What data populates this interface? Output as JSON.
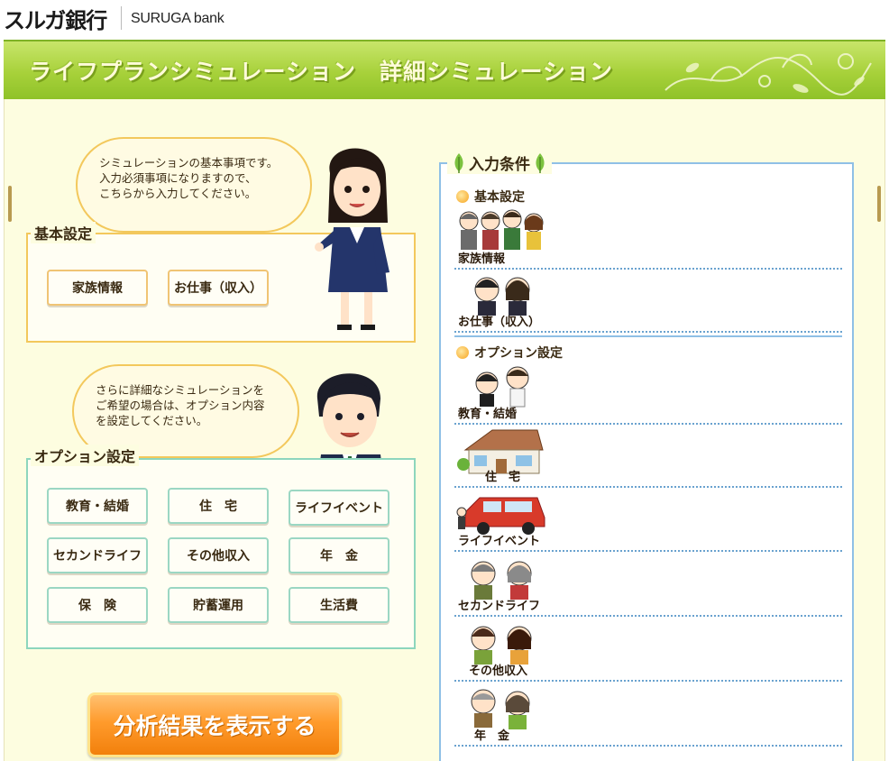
{
  "header": {
    "logo_jp": "スルガ銀行",
    "logo_en": "SURUGA bank"
  },
  "banner": {
    "title": "ライフプランシミュレーション　詳細シミュレーション"
  },
  "basic": {
    "bubble_lines": [
      "シミュレーションの基本事項です。",
      "入力必須事項になりますので、",
      "こちらから入力してください。"
    ],
    "title": "基本設定",
    "buttons": [
      "家族情報",
      "お仕事（収入）"
    ]
  },
  "option": {
    "bubble_lines": [
      "さらに詳細なシミュレーションを",
      "ご希望の場合は、オプション内容",
      "を設定してください。"
    ],
    "title": "オプション設定",
    "buttons": [
      "教育・結婚",
      "住　宅",
      "ライフイベント",
      "セカンドライフ",
      "その他収入",
      "年　金",
      "保　険",
      "貯蓄運用",
      "生活費"
    ]
  },
  "cta": {
    "label": "分析結果を表示する"
  },
  "panel": {
    "title": "入力条件",
    "basic_label": "基本設定",
    "basic_items": [
      "家族情報",
      "お仕事（収入）"
    ],
    "option_label": "オプション設定",
    "option_items": [
      "教育・結婚",
      "住　宅",
      "ライフイベント",
      "セカンドライフ",
      "その他収入",
      "年　金"
    ]
  },
  "colors": {
    "banner_green": "#a7d13a",
    "basic_border": "#f3c85c",
    "option_border": "#8dd6bd",
    "panel_border": "#8fc0e6",
    "cta_orange": "#ff9b2c"
  }
}
